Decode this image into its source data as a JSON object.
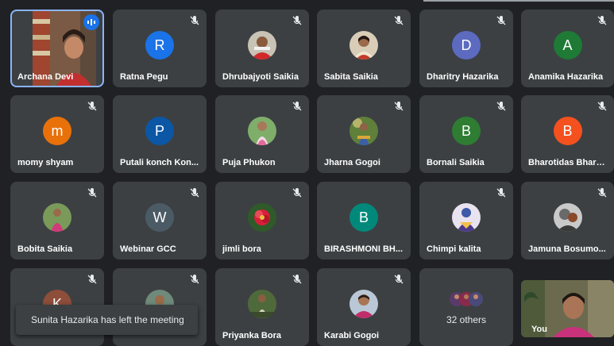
{
  "participants": [
    {
      "name": "Archana Devi",
      "type": "video",
      "speaking": true
    },
    {
      "name": "Ratna Pegu",
      "type": "initial",
      "initial": "R",
      "color": "#1a73e8"
    },
    {
      "name": "Dhrubajyoti Saikia",
      "type": "photo"
    },
    {
      "name": "Sabita Saikia",
      "type": "photo"
    },
    {
      "name": "Dharitry Hazarika",
      "type": "initial",
      "initial": "D",
      "color": "#5c6bc0"
    },
    {
      "name": "Anamika Hazarika",
      "type": "initial",
      "initial": "A",
      "color": "#1e7a34"
    },
    {
      "name": "momy shyam",
      "type": "initial",
      "initial": "m",
      "color": "#e8710a"
    },
    {
      "name": "Putali konch Kon...",
      "type": "initial",
      "initial": "P",
      "color": "#0b57a6"
    },
    {
      "name": "Puja Phukon",
      "type": "photo"
    },
    {
      "name": "Jharna Gogoi",
      "type": "photo"
    },
    {
      "name": "Bornali Saikia",
      "type": "initial",
      "initial": "B",
      "color": "#2e7d32"
    },
    {
      "name": "Bharotidas Bharo...",
      "type": "initial",
      "initial": "B",
      "color": "#f4511e"
    },
    {
      "name": "Bobita Saikia",
      "type": "photo"
    },
    {
      "name": "Webinar GCC",
      "type": "initial",
      "initial": "W",
      "color": "#4b5b66"
    },
    {
      "name": "jimli bora",
      "type": "photo"
    },
    {
      "name": "BIRASHMONI BH...",
      "type": "initial",
      "initial": "B",
      "color": "#00897b"
    },
    {
      "name": "Chimpi kalita",
      "type": "photo"
    },
    {
      "name": "Jamuna Bosumo...",
      "type": "photo"
    },
    {
      "name": "",
      "type": "initial",
      "initial": "K",
      "color": "#8d4e3a"
    },
    {
      "name": "",
      "type": "photo"
    },
    {
      "name": "Priyanka Bora",
      "type": "photo"
    },
    {
      "name": "Karabi Gogoi",
      "type": "photo"
    }
  ],
  "others": {
    "label": "32 others"
  },
  "self_view": {
    "label": "You"
  },
  "toast": {
    "message": "Sunita Hazarika has left the meeting"
  }
}
